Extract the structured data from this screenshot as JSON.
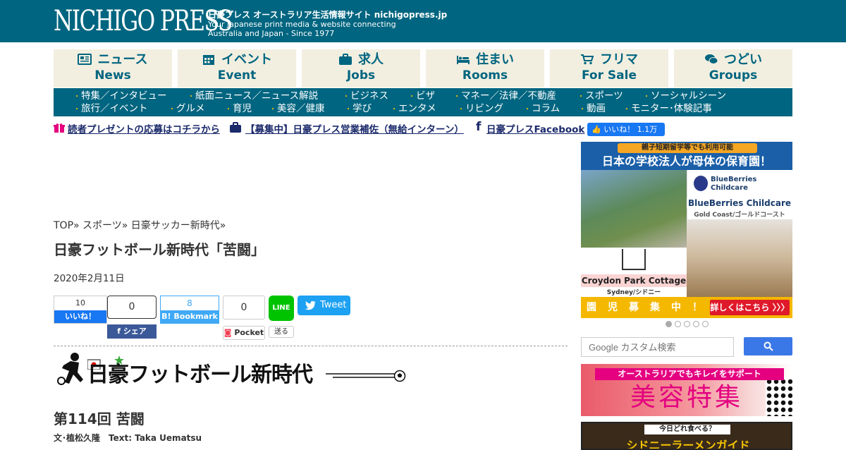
{
  "header": {
    "logo": "NICHIGO PRESS",
    "tagline_jp": "日豪プレス オーストラリア生活情報サイト nichigopress.jp",
    "tagline_en_1": "Your Japanese print media & website connecting",
    "tagline_en_2": "Australia and Japan - Since 1977"
  },
  "tabs": [
    {
      "jp": "ニュース",
      "en": "News",
      "icon": "newspaper-icon"
    },
    {
      "jp": "イベント",
      "en": "Event",
      "icon": "calendar-icon"
    },
    {
      "jp": "求人",
      "en": "Jobs",
      "icon": "briefcase-icon"
    },
    {
      "jp": "住まい",
      "en": "Rooms",
      "icon": "bed-icon"
    },
    {
      "jp": "フリマ",
      "en": "For Sale",
      "icon": "cart-icon"
    },
    {
      "jp": "つどい",
      "en": "Groups",
      "icon": "chat-icon"
    }
  ],
  "subnav": {
    "row1": [
      "特集／インタビュー",
      "紙面ニュース／ニュース解説",
      "ビジネス",
      "ビザ",
      "マネー／法律／不動産",
      "スポーツ",
      "ソーシャルシーン"
    ],
    "row2": [
      "旅行／イベント",
      "グルメ",
      "育児",
      "美容／健康",
      "学び",
      "エンタメ",
      "リビング",
      "コラム",
      "動画",
      "モニター･体験記事"
    ]
  },
  "promo": {
    "present": "読者プレゼントの応募はコチラから",
    "intern": "【募集中】日豪プレス営業補佐（無給インターン）",
    "facebook": "日豪プレスFacebook",
    "fb_like": "いいね！ 1.1万"
  },
  "article": {
    "breadcrumb": "TOP» スポーツ» 日豪サッカー新時代»",
    "title": "日豪フットボール新時代「苦闘」",
    "date": "2020年2月11日",
    "series_banner": "日豪フットボール新時代",
    "episode": "第114回 苦闘",
    "credit": "文･植松久隆　Text: Taka Uematsu"
  },
  "share": {
    "fb_count": "10",
    "fb_like": "いいね！",
    "fb_share_count": "0",
    "fb_share": "シェア",
    "hatena_count": "8",
    "hatena": "B! Bookmark",
    "pocket_count": "0",
    "pocket": "Pocket",
    "line": "LINE",
    "line_send": "送る",
    "tweet": "Tweet"
  },
  "sidebar": {
    "ad1": {
      "pill": "親子短期留学等でも利用可能",
      "headline": "日本の学校法人が母体の保育園！",
      "brand_small": "BlueBerries Childcare",
      "brand": "BlueBerries Childcare",
      "brand_loc": "Gold Coast/ゴールドコースト",
      "cottage": "Croydon Park Cottage",
      "cottage_loc": "Sydney/シドニー",
      "chars": [
        "園",
        "児",
        "募",
        "集",
        "中",
        "！"
      ],
      "cta": "詳しくはこちら 〉〉〉"
    },
    "search_placeholder": "Google カスタム検索",
    "ad2": {
      "bar": "オーストラリアでもキレイをサポート",
      "headline": "美容特集"
    },
    "ad3": {
      "bar": "今日どれ食べる？",
      "headline": "シドニーラーメンガイド"
    }
  },
  "colors": {
    "brand_teal": "#006580",
    "tab_bg": "#f2efe0",
    "facebook_blue": "#1877f2",
    "twitter_blue": "#1da1f2",
    "line_green": "#00c300"
  }
}
